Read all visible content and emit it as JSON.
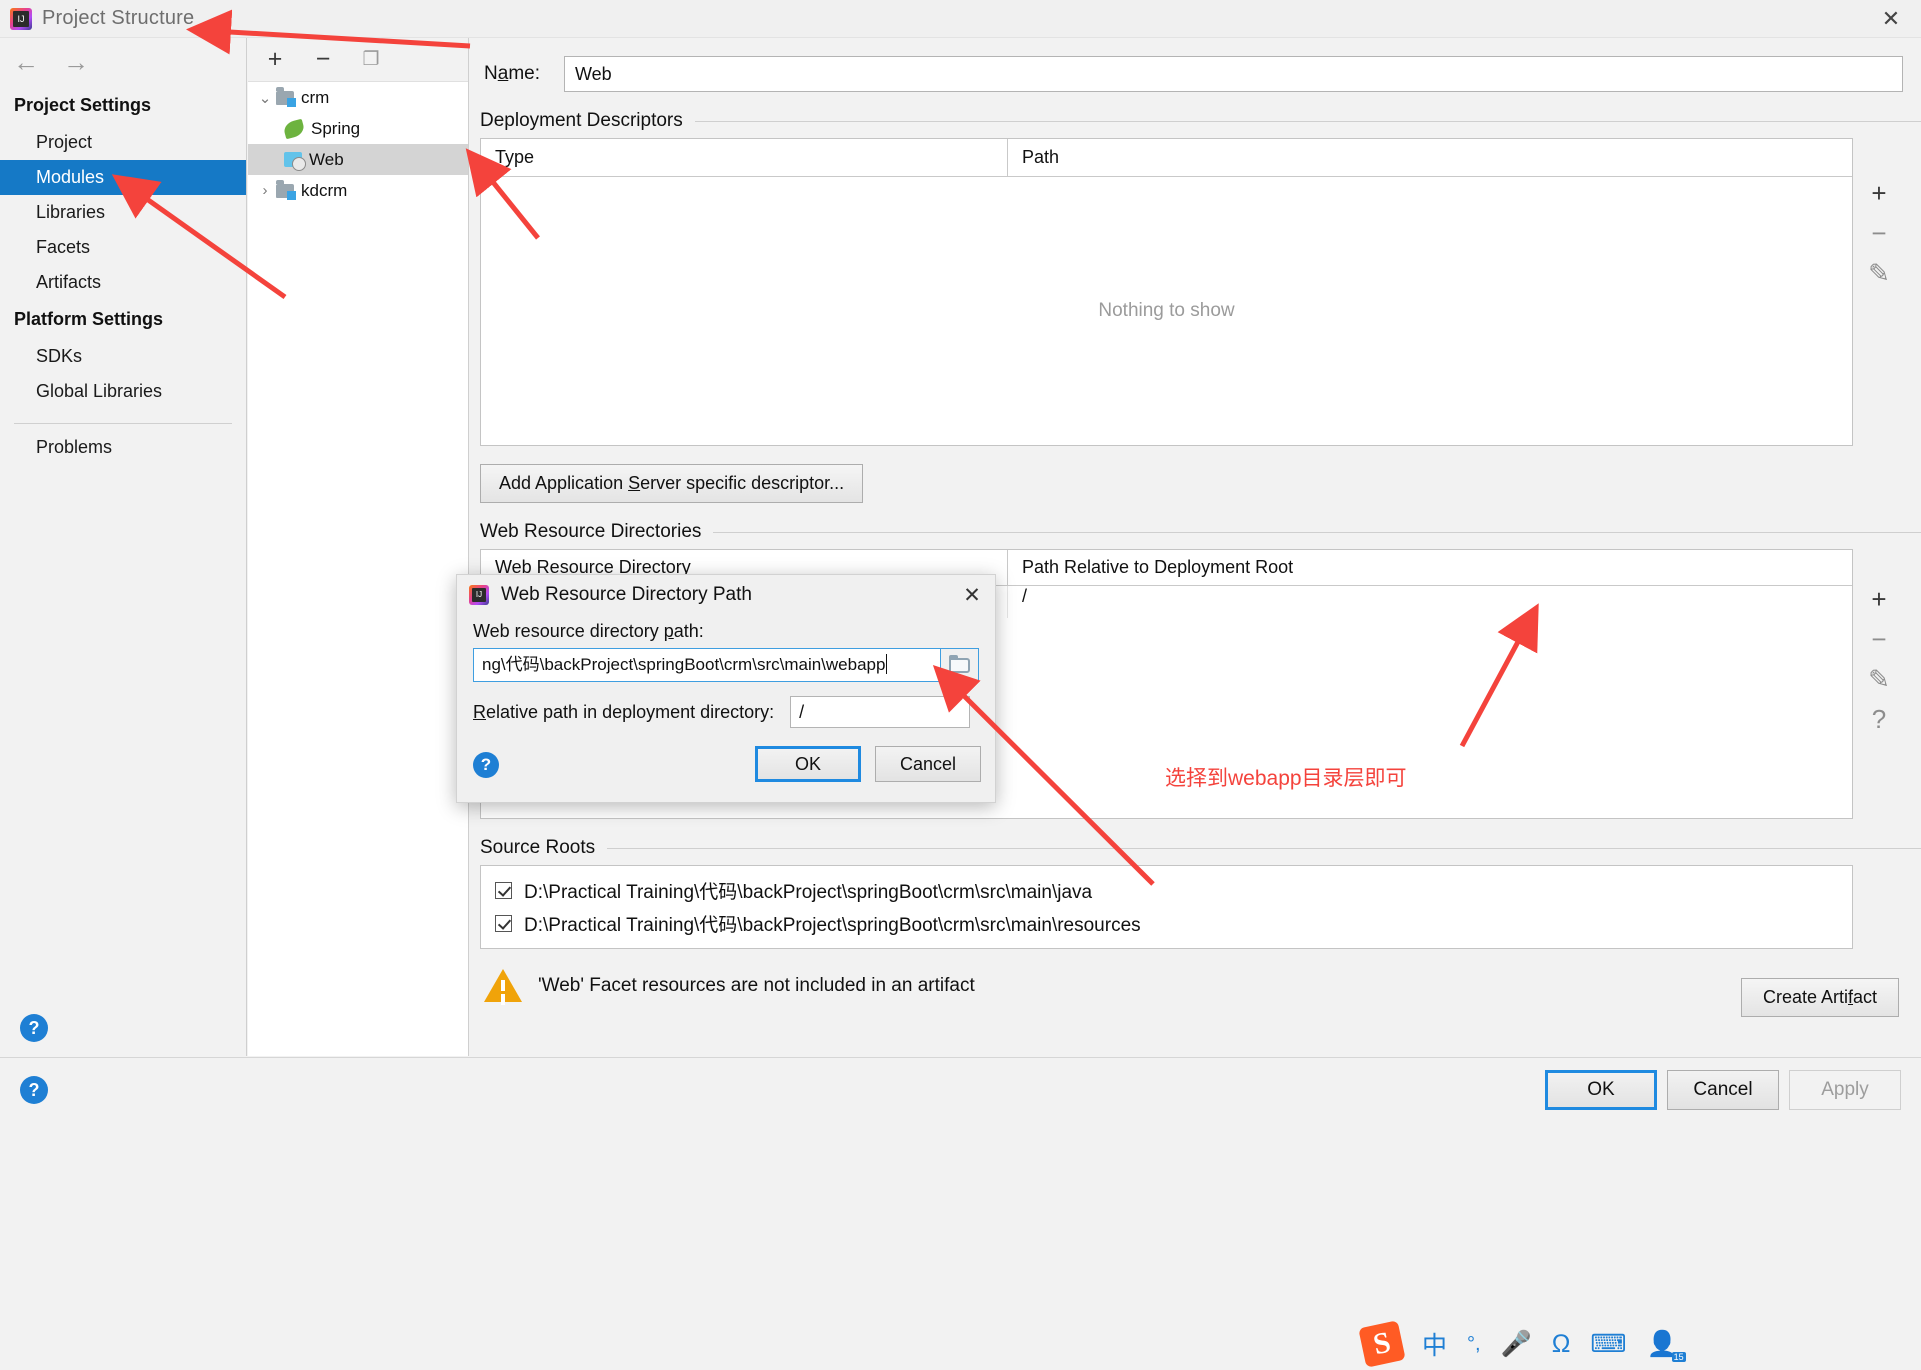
{
  "window": {
    "title": "Project Structure",
    "app_icon": "intellij-idea-icon",
    "close_label": "✕"
  },
  "sidebar": {
    "back_label": "←",
    "forward_label": "→",
    "groups": [
      {
        "label": "Project Settings",
        "items": [
          {
            "label": "Project",
            "selected": false
          },
          {
            "label": "Modules",
            "selected": true
          },
          {
            "label": "Libraries",
            "selected": false
          },
          {
            "label": "Facets",
            "selected": false
          },
          {
            "label": "Artifacts",
            "selected": false
          }
        ]
      },
      {
        "label": "Platform Settings",
        "items": [
          {
            "label": "SDKs",
            "selected": false
          },
          {
            "label": "Global Libraries",
            "selected": false
          }
        ]
      }
    ],
    "problems_label": "Problems",
    "help_label": "?"
  },
  "tree": {
    "toolbar": {
      "add": "+",
      "remove": "−",
      "copy": "❐"
    },
    "nodes": [
      {
        "label": "crm",
        "icon": "folder-module-icon",
        "twisty": "⌄",
        "level": 0,
        "selected": false
      },
      {
        "label": "Spring",
        "icon": "spring-icon",
        "twisty": "",
        "level": 1,
        "selected": false
      },
      {
        "label": "Web",
        "icon": "web-facet-icon",
        "twisty": "",
        "level": 1,
        "selected": true
      },
      {
        "label": "kdcrm",
        "icon": "folder-module-icon",
        "twisty": "›",
        "level": 0,
        "selected": false
      }
    ]
  },
  "main": {
    "name_label_prefix": "N",
    "name_label_underlined": "a",
    "name_label_suffix": "me:",
    "name_value": "Web",
    "deployment_descriptors": {
      "title": "Deployment Descriptors",
      "columns": [
        "Type",
        "Path"
      ],
      "empty_text": "Nothing to show",
      "controls": {
        "add": "+",
        "remove": "−",
        "edit": "✎"
      }
    },
    "add_descriptor_button": {
      "prefix": "Add Application ",
      "underlined": "S",
      "suffix": "erver specific descriptor..."
    },
    "web_resource_directories": {
      "title": "Web Resource Directories",
      "columns": [
        "Web Resource Directory",
        "Path Relative to Deployment Root"
      ],
      "rows": [
        {
          "directory": "",
          "relative_path": "/"
        }
      ],
      "controls": {
        "add": "+",
        "remove": "−",
        "edit": "✎",
        "help": "?"
      }
    },
    "source_roots": {
      "title": "Source Roots",
      "items": [
        {
          "checked": true,
          "path": "D:\\Practical Training\\代码\\backProject\\springBoot\\crm\\src\\main\\java"
        },
        {
          "checked": true,
          "path": "D:\\Practical Training\\代码\\backProject\\springBoot\\crm\\src\\main\\resources"
        }
      ]
    },
    "warning": {
      "icon": "warning-triangle-icon",
      "text": "'Web' Facet resources are not included in an artifact"
    },
    "create_artifact_button": {
      "prefix": "Create Arti",
      "underlined": "f",
      "suffix": "act"
    }
  },
  "footer": {
    "help_label": "?",
    "buttons": [
      {
        "label": "OK",
        "style": "default",
        "disabled": false
      },
      {
        "label": "Cancel",
        "style": "normal",
        "disabled": false
      },
      {
        "label": "Apply",
        "style": "normal",
        "disabled": true
      }
    ]
  },
  "modal": {
    "app_icon": "intellij-idea-icon",
    "title": "Web Resource Directory Path",
    "close_label": "✕",
    "path_label": {
      "prefix": "Web resource directory ",
      "underlined": "p",
      "suffix": "ath:"
    },
    "path_value": "ng\\代码\\backProject\\springBoot\\crm\\src\\main\\webapp",
    "browse_icon": "folder-browse-icon",
    "relative_label": {
      "prefix": "",
      "underlined": "R",
      "suffix": "elative path in deployment directory:"
    },
    "relative_value": "/",
    "help_label": "?",
    "buttons": [
      {
        "label": "OK",
        "style": "default"
      },
      {
        "label": "Cancel",
        "style": "normal"
      }
    ]
  },
  "annotations": {
    "color": "#f4433c",
    "note_webapp": "选择到webapp目录层即可"
  },
  "ime": {
    "logo": "S",
    "mode": "中",
    "items": [
      "°,",
      "🎤",
      "Ω",
      "⌨",
      "👤"
    ]
  }
}
